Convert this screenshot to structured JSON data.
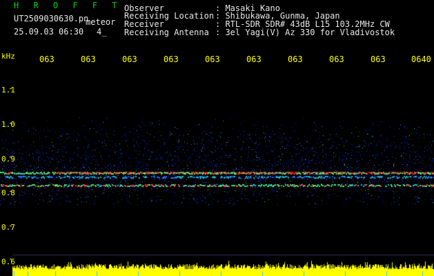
{
  "header": {
    "program": "H R O F F T",
    "filename": "UT2509030630.pn",
    "mode": "meteor",
    "datetime": "25.09.03 06:30",
    "count": "4_",
    "fields": [
      {
        "label": "Observer",
        "value": ": Masaki Kano"
      },
      {
        "label": "Receiving Location",
        "value": ": Shibukawa, Gunma, Japan"
      },
      {
        "label": "Receiver",
        "value": ": RTL-SDR SDR# 43dB L15 103.2MHz CW"
      },
      {
        "label": "Receiving Antenna",
        "value": ": 3el Yagi(V) Az 330 for Vladivostok"
      }
    ]
  },
  "axis": {
    "unit": "kHz",
    "y_ticks": [
      "1.1",
      "1.0",
      "0.9",
      "0.8",
      "0.7",
      "0.6"
    ],
    "x_ticks": [
      "063",
      "063",
      "063",
      "063",
      "063",
      "063",
      "063",
      "063",
      "063",
      "0640"
    ]
  },
  "colors": {
    "background": "#000000",
    "label": "#ffff00",
    "title": "#00d200",
    "text": "#e8e8e8",
    "signal_line": "#ff2020",
    "noise": "#1a40ff",
    "amplitude_bar": "#ffff00",
    "tick_marks": "#40c8ff"
  }
}
